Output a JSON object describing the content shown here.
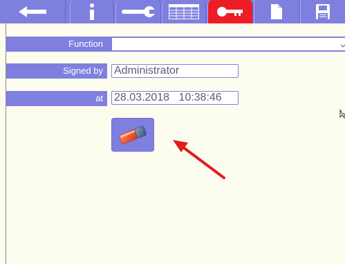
{
  "toolbar": {
    "buttons": [
      {
        "icon": "back-arrow-icon"
      },
      {
        "icon": "info-icon"
      },
      {
        "icon": "wrench-icon"
      },
      {
        "icon": "table-icon"
      },
      {
        "icon": "key-icon",
        "active": true
      },
      {
        "icon": "document-icon"
      },
      {
        "icon": "save-icon"
      }
    ],
    "background_color": "#7f7fdf",
    "active_color": "#ee1c24"
  },
  "form": {
    "function_label": "Function",
    "function_value": "",
    "signed_by_label": "Signed by",
    "signed_by_value": "Administrator",
    "at_label": "at",
    "at_value": "28.03.2018   10:38:46"
  },
  "actions": {
    "clear_signature_icon": "eraser-icon"
  },
  "colors": {
    "page_background": "#fdfdef",
    "label_background": "#7f7fdf",
    "annotation_arrow": "#e21b1b"
  }
}
